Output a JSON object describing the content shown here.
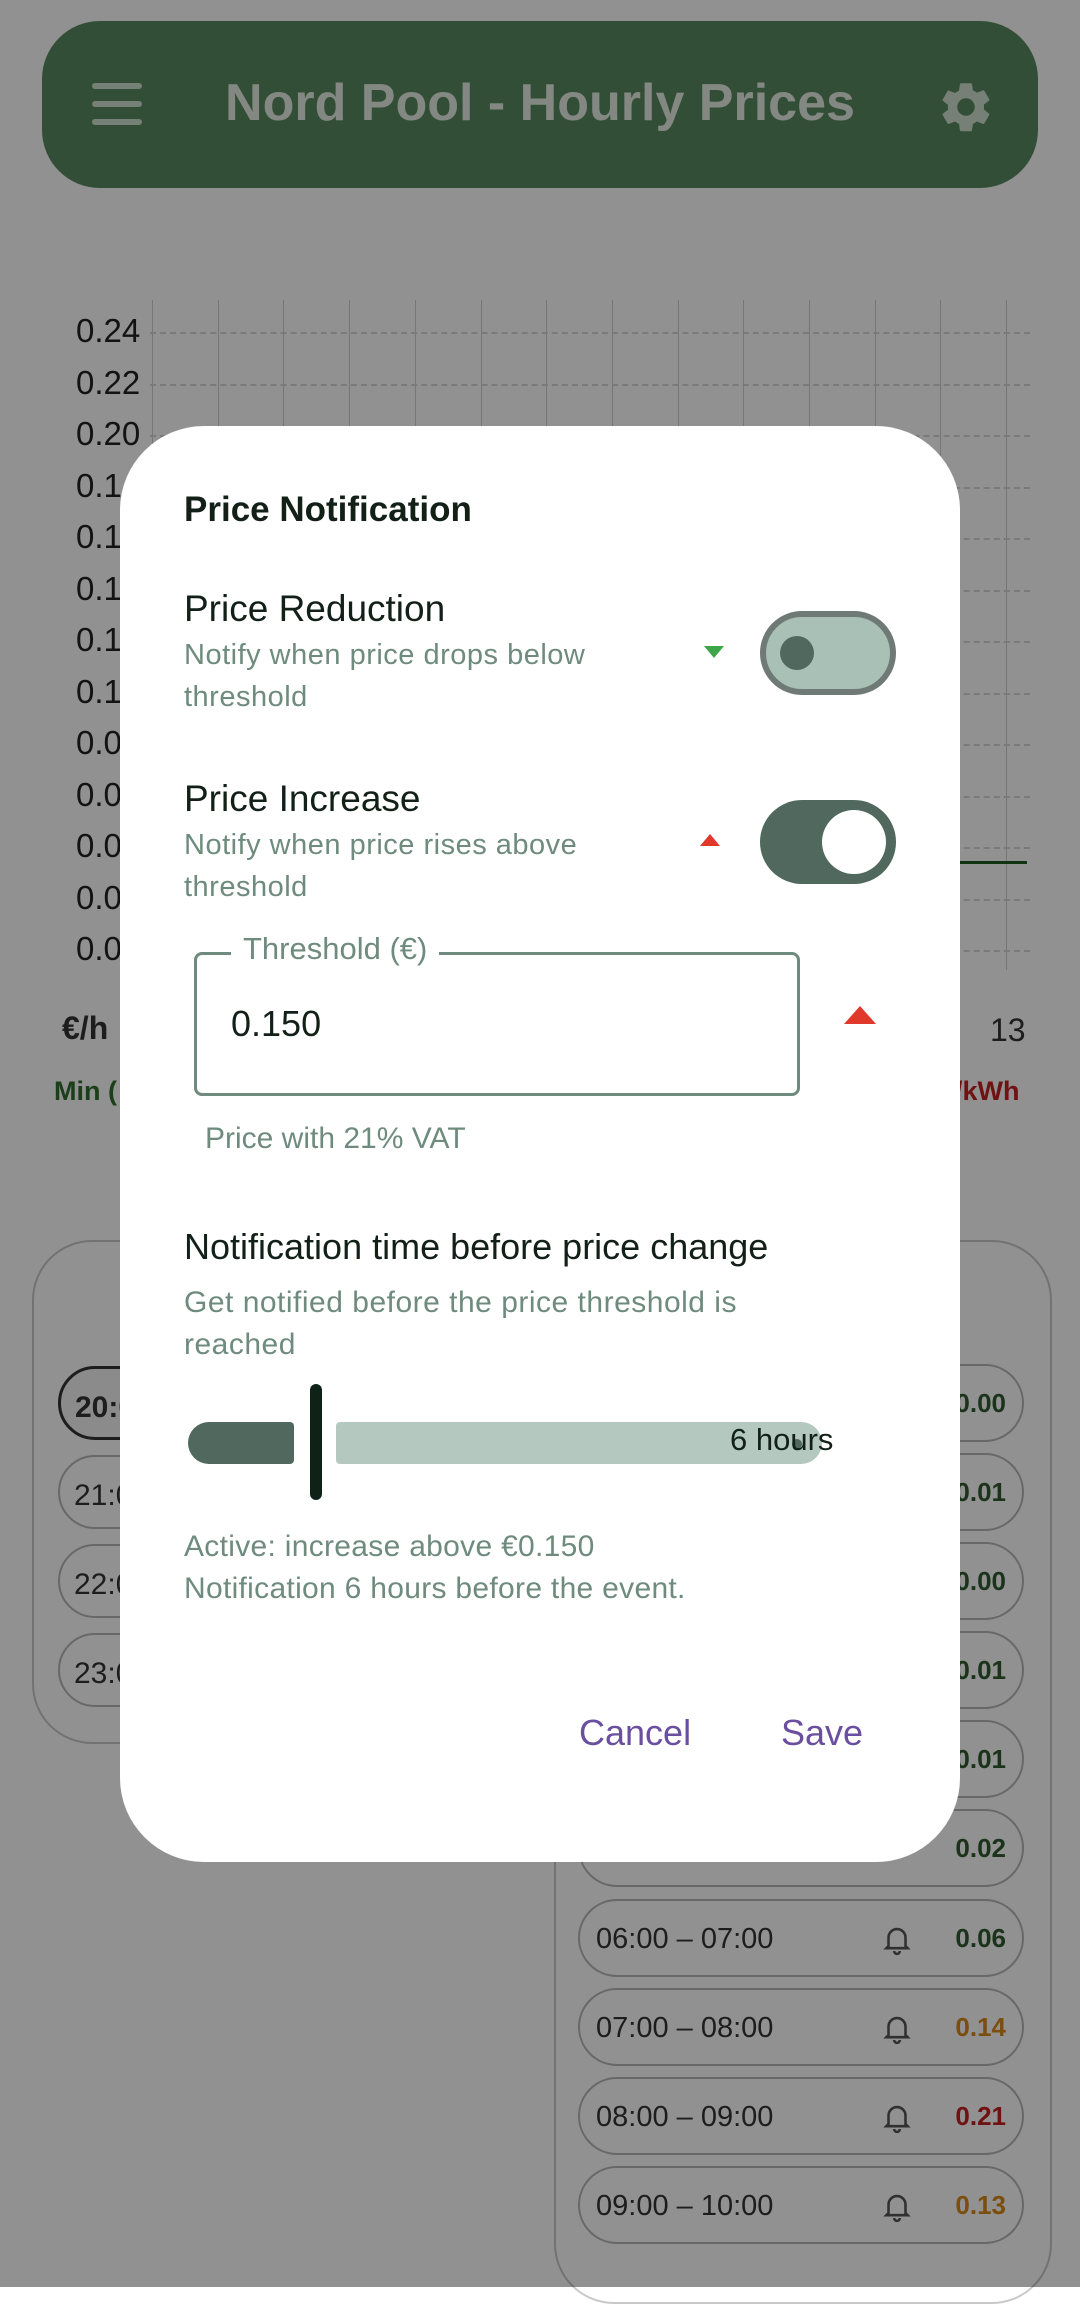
{
  "app": {
    "title": "Nord Pool - Hourly Prices"
  },
  "chart": {
    "y_ticks": [
      "0.24",
      "0.22",
      "0.20",
      "0.1",
      "0.1",
      "0.1",
      "0.1",
      "0.1",
      "0.0",
      "0.0",
      "0.0",
      "0.0",
      "0.0"
    ],
    "unit_label": "€/h",
    "x_last": "13",
    "min_label": "Min (",
    "unit_right": "/kWh"
  },
  "chart_data": {
    "type": "line",
    "ylim": [
      0,
      0.24
    ],
    "y_ticks": [
      0.24,
      0.22,
      0.2
    ]
  },
  "left_list": {
    "items": [
      {
        "label": "20:0",
        "active": true
      },
      {
        "label": "21:0",
        "active": false
      },
      {
        "label": "22:0",
        "active": false
      },
      {
        "label": "23:0",
        "active": false
      }
    ]
  },
  "right_list": {
    "partial_values": [
      "0.00",
      "0.01",
      "0.00",
      "0.01",
      "0.01",
      "0.02"
    ],
    "slots": [
      {
        "time": "06:00 – 07:00",
        "value": "0.06",
        "color": "#2e5a2e"
      },
      {
        "time": "07:00 – 08:00",
        "value": "0.14",
        "color": "#d98a1a"
      },
      {
        "time": "08:00 – 09:00",
        "value": "0.21",
        "color": "#c52020"
      },
      {
        "time": "09:00 – 10:00",
        "value": "0.13",
        "color": "#d98a1a"
      }
    ]
  },
  "dialog": {
    "title": "Price Notification",
    "reduction": {
      "title": "Price Reduction",
      "subtitle": "Notify when price drops below threshold",
      "enabled": false
    },
    "increase": {
      "title": "Price Increase",
      "subtitle": "Notify when price rises above threshold",
      "enabled": true
    },
    "threshold": {
      "label": "Threshold (€)",
      "value": "0.150",
      "helper": "Price with 21% VAT"
    },
    "timing": {
      "title": "Notification time before price change",
      "subtitle": "Get notified before the price threshold is reached",
      "value_label": "6 hours",
      "level": 0.15
    },
    "status_line1": "Active: increase above €0.150",
    "status_line2": "Notification 6 hours before the event.",
    "cancel": "Cancel",
    "save": "Save"
  },
  "colors": {
    "accent": "#50685e",
    "button": "#6a4fa0",
    "increase": "#e0382b",
    "reduction": "#3ea648"
  }
}
